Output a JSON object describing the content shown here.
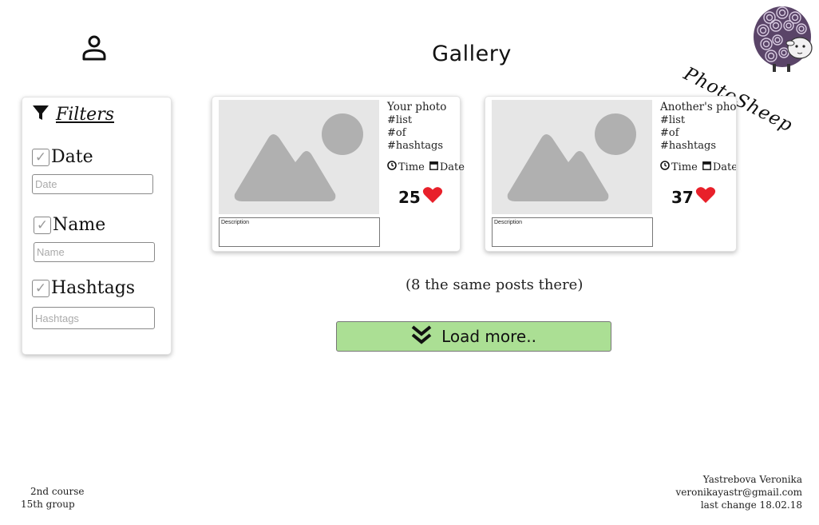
{
  "header": {
    "title": "Gallery",
    "user_icon": "user-icon"
  },
  "logo": {
    "text": "PhotoSheep",
    "icon": "sheep-logo"
  },
  "filters": {
    "title": "Filters",
    "icon": "filter-icon",
    "items": [
      {
        "label": "Date",
        "checked": true,
        "placeholder": "Date"
      },
      {
        "label": "Name",
        "checked": true,
        "placeholder": "Name"
      },
      {
        "label": "Hashtags",
        "checked": true,
        "placeholder": "Hashtags"
      }
    ]
  },
  "cards": [
    {
      "title": "Your photo",
      "hashtags": [
        "#list",
        "#of",
        "#hashtags"
      ],
      "time_label": "Time",
      "date_label": "Date",
      "likes": "25",
      "description_label": "Description"
    },
    {
      "title": "Another's photo",
      "hashtags": [
        "#list",
        "#of",
        "#hashtags"
      ],
      "time_label": "Time",
      "date_label": "Date",
      "likes": "37",
      "description_label": "Description"
    }
  ],
  "posts_note": "(8 the same posts there)",
  "load_more": {
    "label": "Load more..",
    "icon": "double-chevron-down-icon"
  },
  "footer": {
    "left": [
      "2nd course",
      "15th group"
    ],
    "right": [
      "Yastrebova Veronika",
      "veronikayastr@gmail.com",
      "last change 18.02.18"
    ]
  },
  "colors": {
    "load_more_bg": "#abdf94",
    "heart": "#e8202a",
    "image_placeholder": "#e6e6e6",
    "image_shapes": "#b0b0b0"
  }
}
